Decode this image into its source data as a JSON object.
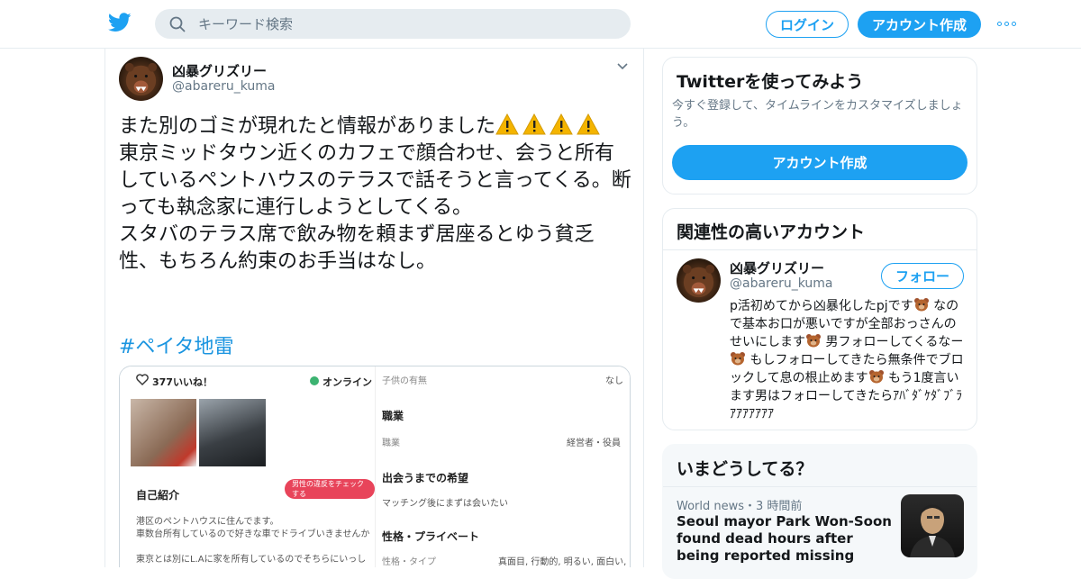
{
  "header": {
    "search_placeholder": "キーワード検索",
    "login_label": "ログイン",
    "signup_label": "アカウント作成"
  },
  "tweet": {
    "name": "凶暴グリズリー",
    "handle": "@abareru_kuma",
    "line1": "また別のゴミが現れたと情報がありました",
    "body": "東京ミッドタウン近くのカフェで顔合わせ、会うと所有しているペントハウスのテラスで話そうと言ってくる。断っても執念家に連行しようとしてくる。\nスタバのテラス席で飲み物を頼まず居座るとゆう貧乏性、もちろん約束のお手当はなし。",
    "hashtag": "#ペイタ地雷",
    "media": {
      "likes": "377いいね！",
      "online": "オンライン",
      "self_intro": "自己紹介",
      "badge": "男性の違反をチェックする",
      "intro_text1": "港区のペントハウスに住んでます。",
      "intro_text2": "車数台所有しているので好きな車でドライブいきませんか",
      "intro_text3": "東京とは別にL.Aに家を所有しているのでそちらにいっしょ",
      "children_label": "子供の有無",
      "children_value": "なし",
      "job_heading": "職業",
      "job_label": "職業",
      "job_value": "経営者・役員",
      "meet_heading": "出会うまでの希望",
      "meet_value": "マッチング後にまずは会いたい",
      "personality_heading": "性格・プライベート",
      "personality_label": "性格・タイプ",
      "personality_value": "真面目, 行動的, 明るい, 面白い,"
    }
  },
  "try_card": {
    "title": "Twitterを使ってみよう",
    "desc": "今すぐ登録して、タイムラインをカスタマイズしましょう。",
    "button": "アカウント作成"
  },
  "related": {
    "title": "関連性の高いアカウント",
    "name": "凶暴グリズリー",
    "handle": "@abareru_kuma",
    "follow": "フォロー",
    "bio1": "p活初めてから凶暴化したpjです",
    "bio2": " なので基本お口が悪いですが全部おっさんのせいにします",
    "bio3": " 男フォローしてくるなー",
    "bio4": " もしフォローしてきたら無条件でブロックして息の根止めます",
    "bio5": " もう1度言います男はフォローしてきたらｱﾊﾞﾀﾞｹﾀﾞﾌﾞﾗｱｱｱｱｱｱｱ"
  },
  "whats_happening": {
    "title": "いまどうしてる？",
    "meta": "World news・3 時間前",
    "headline": "Seoul mayor Park Won-Soon found dead hours after being reported missing"
  },
  "colors": {
    "accent": "#1da1f2",
    "link": "#1b95e0",
    "muted": "#657786"
  }
}
